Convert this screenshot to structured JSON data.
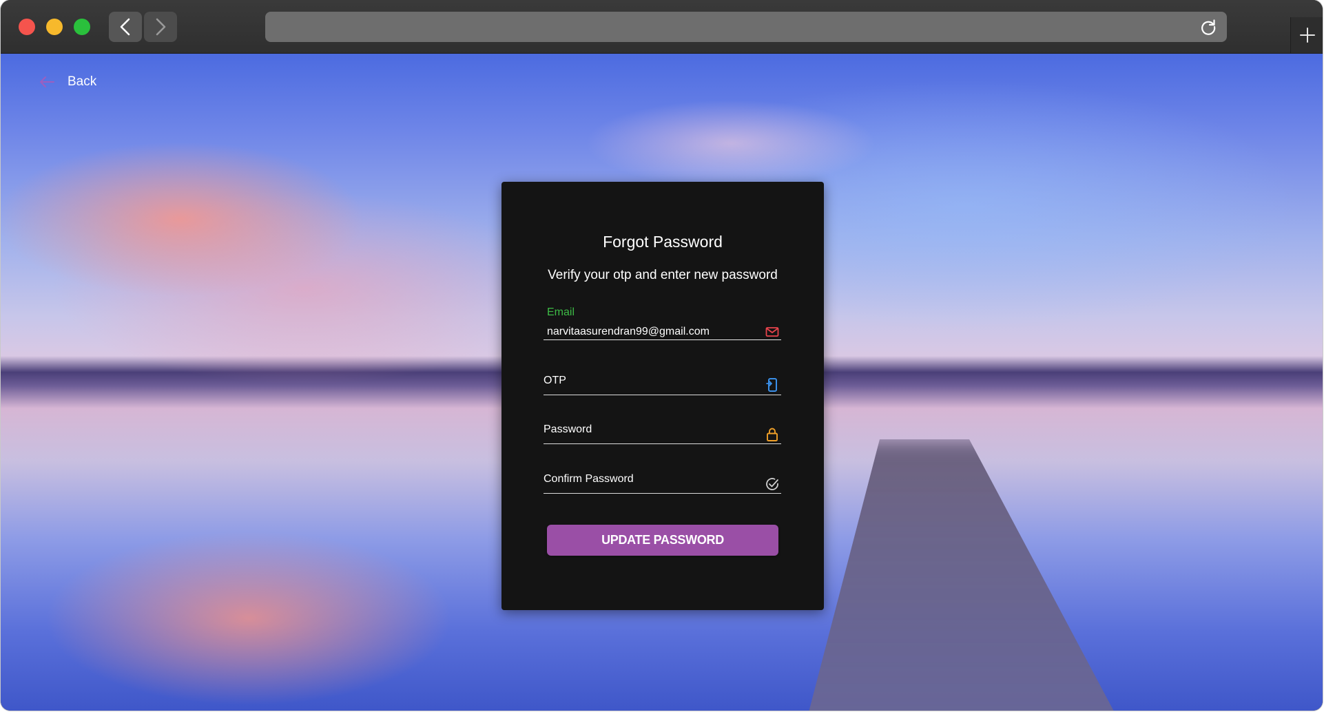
{
  "browser": {
    "url": ""
  },
  "page": {
    "back_label": "Back"
  },
  "form": {
    "title": "Forgot Password",
    "subtitle": "Verify your otp and enter new password",
    "email": {
      "label": "Email",
      "value": "narvitaasurendran99@gmail.com",
      "label_color": "#3dbb46",
      "icon": "mail-icon",
      "icon_color": "#e8444c"
    },
    "otp": {
      "label": "OTP",
      "value": "",
      "icon": "mobile-icon",
      "icon_color": "#3a8fe8"
    },
    "password": {
      "label": "Password",
      "value": "",
      "icon": "lock-icon",
      "icon_color": "#f0a028"
    },
    "confirm_password": {
      "label": "Confirm Password",
      "value": "",
      "icon": "check-circle-icon",
      "icon_color": "#cfcfcf"
    },
    "submit_label": "UPDATE PASSWORD",
    "submit_color": "#9a4fa6"
  }
}
